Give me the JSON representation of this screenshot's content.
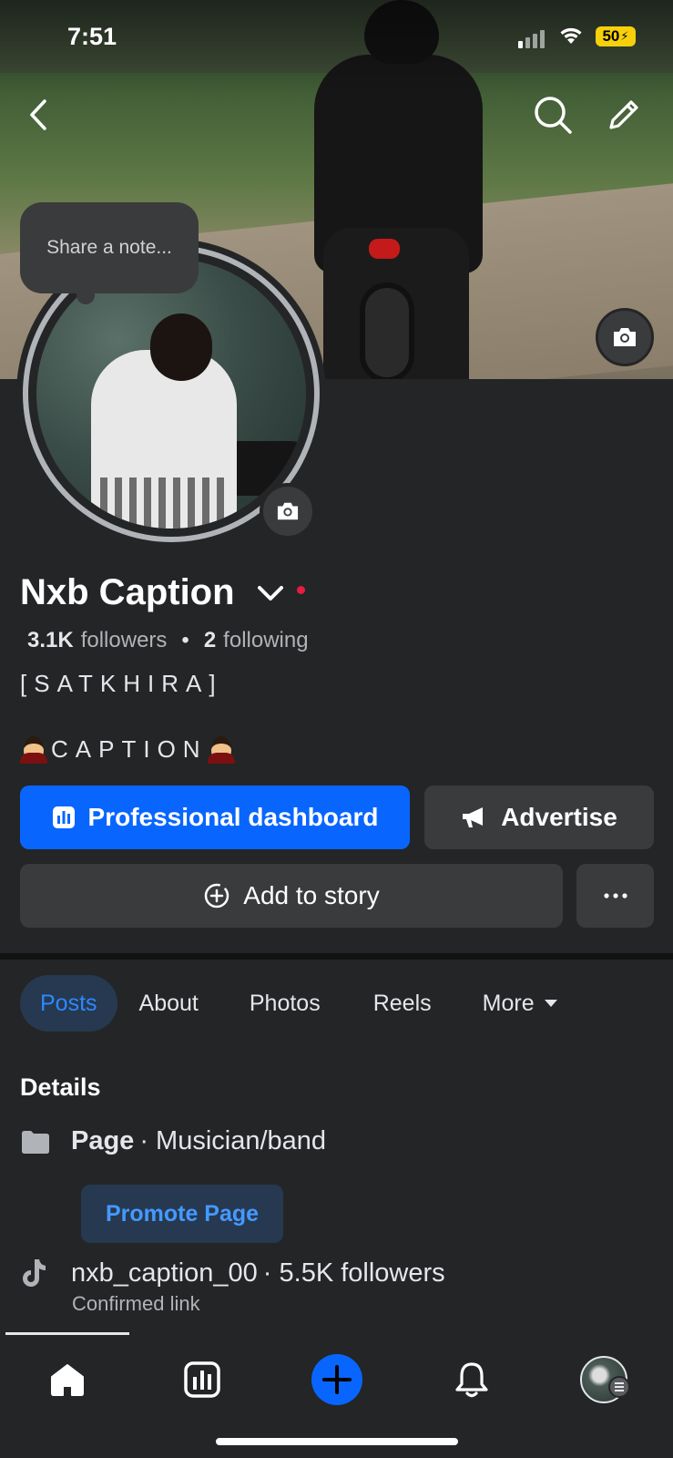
{
  "status_bar": {
    "time": "7:51",
    "battery": "50"
  },
  "profile": {
    "note_placeholder": "Share a note...",
    "name": "Nxb Caption",
    "followers_count": "3.1K",
    "followers_label": "followers",
    "following_count": "2",
    "following_label": "following",
    "bio_line1": "[SATKHIRA]",
    "bio_line2": "CAPTION"
  },
  "actions": {
    "professional_dashboard": "Professional dashboard",
    "advertise": "Advertise",
    "add_to_story": "Add to story"
  },
  "tabs": [
    {
      "label": "Posts",
      "active": true
    },
    {
      "label": "About"
    },
    {
      "label": "Photos"
    },
    {
      "label": "Reels"
    },
    {
      "label": "More"
    }
  ],
  "details": {
    "title": "Details",
    "page_label": "Page",
    "page_category": " · Musician/band",
    "promote_button": "Promote Page",
    "tiktok_handle": "nxb_caption_00",
    "tiktok_followers": " · 5.5K followers",
    "tiktok_status": "Confirmed link"
  },
  "bottom_nav": [
    "home-icon",
    "dashboard-icon",
    "create-icon",
    "notifications-icon",
    "profile-avatar"
  ],
  "colors": {
    "accent": "#0866ff",
    "background": "#242526",
    "surface": "#3a3b3c",
    "active_tab_bg": "#263951",
    "link_blue": "#2d88ff",
    "notice_dot": "#e41e3f"
  }
}
